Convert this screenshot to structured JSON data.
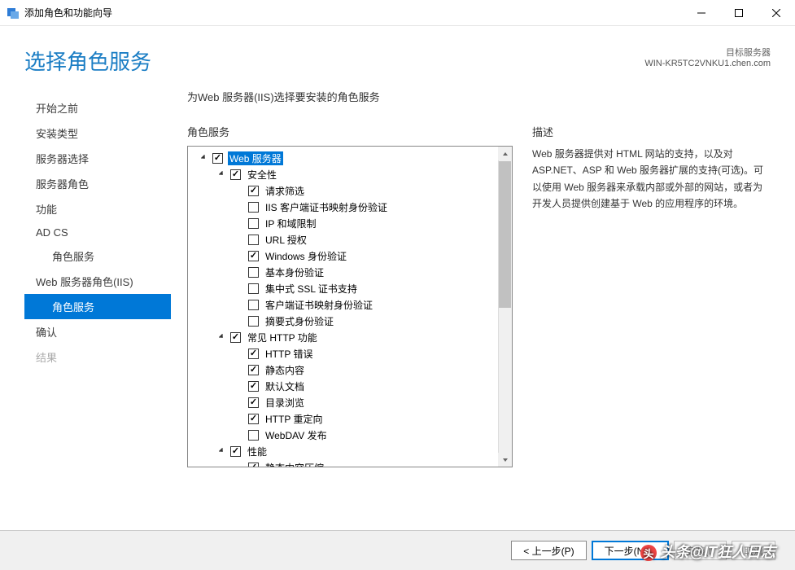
{
  "window": {
    "title": "添加角色和功能向导"
  },
  "header": {
    "page_title": "选择角色服务",
    "server_label": "目标服务器",
    "server_name": "WIN-KR5TC2VNKU1.chen.com"
  },
  "sidebar": {
    "items": [
      {
        "label": "开始之前",
        "indent": false,
        "active": false,
        "disabled": false
      },
      {
        "label": "安装类型",
        "indent": false,
        "active": false,
        "disabled": false
      },
      {
        "label": "服务器选择",
        "indent": false,
        "active": false,
        "disabled": false
      },
      {
        "label": "服务器角色",
        "indent": false,
        "active": false,
        "disabled": false
      },
      {
        "label": "功能",
        "indent": false,
        "active": false,
        "disabled": false
      },
      {
        "label": "AD CS",
        "indent": false,
        "active": false,
        "disabled": false
      },
      {
        "label": "角色服务",
        "indent": true,
        "active": false,
        "disabled": false
      },
      {
        "label": "Web 服务器角色(IIS)",
        "indent": false,
        "active": false,
        "disabled": false
      },
      {
        "label": "角色服务",
        "indent": true,
        "active": true,
        "disabled": false
      },
      {
        "label": "确认",
        "indent": false,
        "active": false,
        "disabled": false
      },
      {
        "label": "结果",
        "indent": false,
        "active": false,
        "disabled": true
      }
    ]
  },
  "main": {
    "instruction": "为Web 服务器(IIS)选择要安装的角色服务",
    "tree_label": "角色服务",
    "desc_label": "描述",
    "description": "Web 服务器提供对 HTML 网站的支持，以及对 ASP.NET、ASP 和 Web 服务器扩展的支持(可选)。可以使用 Web 服务器来承载内部或外部的网站，或者为开发人员提供创建基于 Web 的应用程序的环境。",
    "tree": [
      {
        "depth": 1,
        "expander": "open",
        "checked": true,
        "label": "Web 服务器",
        "selected": true
      },
      {
        "depth": 2,
        "expander": "open",
        "checked": true,
        "label": "安全性"
      },
      {
        "depth": 3,
        "checked": true,
        "label": "请求筛选"
      },
      {
        "depth": 3,
        "checked": false,
        "label": "IIS 客户端证书映射身份验证"
      },
      {
        "depth": 3,
        "checked": false,
        "label": "IP 和域限制"
      },
      {
        "depth": 3,
        "checked": false,
        "label": "URL 授权"
      },
      {
        "depth": 3,
        "checked": true,
        "label": "Windows 身份验证"
      },
      {
        "depth": 3,
        "checked": false,
        "label": "基本身份验证"
      },
      {
        "depth": 3,
        "checked": false,
        "label": "集中式 SSL 证书支持"
      },
      {
        "depth": 3,
        "checked": false,
        "label": "客户端证书映射身份验证"
      },
      {
        "depth": 3,
        "checked": false,
        "label": "摘要式身份验证"
      },
      {
        "depth": 2,
        "expander": "open",
        "checked": true,
        "label": "常见 HTTP 功能"
      },
      {
        "depth": 3,
        "checked": true,
        "label": "HTTP 错误"
      },
      {
        "depth": 3,
        "checked": true,
        "label": "静态内容"
      },
      {
        "depth": 3,
        "checked": true,
        "label": "默认文档"
      },
      {
        "depth": 3,
        "checked": true,
        "label": "目录浏览"
      },
      {
        "depth": 3,
        "checked": true,
        "label": "HTTP 重定向"
      },
      {
        "depth": 3,
        "checked": false,
        "label": "WebDAV 发布"
      },
      {
        "depth": 2,
        "expander": "open",
        "checked": true,
        "label": "性能"
      },
      {
        "depth": 3,
        "checked": true,
        "label": "静态内容压缩"
      }
    ]
  },
  "footer": {
    "prev": "< 上一步(P)",
    "next": "下一步(N) >",
    "install": "安装(I)",
    "cancel": "取消"
  },
  "watermark": "头条@IT狂人日志"
}
